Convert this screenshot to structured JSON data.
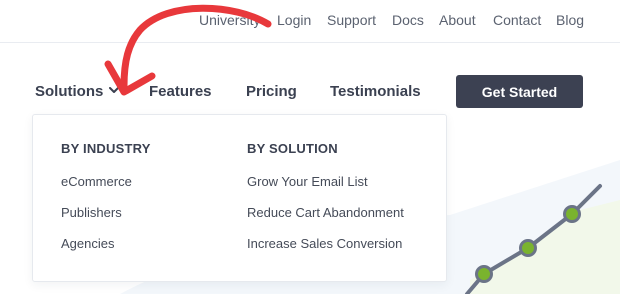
{
  "topbar": {
    "links": {
      "university": "University",
      "login": "Login",
      "support": "Support",
      "docs": "Docs",
      "about": "About",
      "contact": "Contact",
      "blog": "Blog"
    }
  },
  "nav": {
    "solutions": "Solutions",
    "features": "Features",
    "pricing": "Pricing",
    "testimonials": "Testimonials",
    "cta": "Get Started"
  },
  "dropdown": {
    "by_industry": {
      "heading": "BY INDUSTRY",
      "items": [
        "eCommerce",
        "Publishers",
        "Agencies"
      ]
    },
    "by_solution": {
      "heading": "BY SOLUTION",
      "items": [
        "Grow Your Email List",
        "Reduce Cart Abandonment",
        "Increase Sales Conversion"
      ]
    }
  },
  "colors": {
    "nav_text": "#3b4151",
    "cta_bg": "#3c4152",
    "annotation_red": "#e8383b",
    "chart_line": "#6b7487",
    "chart_point": "#7ab32e"
  },
  "icons": {
    "solutions_chevron": "chevron-down-icon",
    "annotation": "red-arrow-annotation"
  }
}
